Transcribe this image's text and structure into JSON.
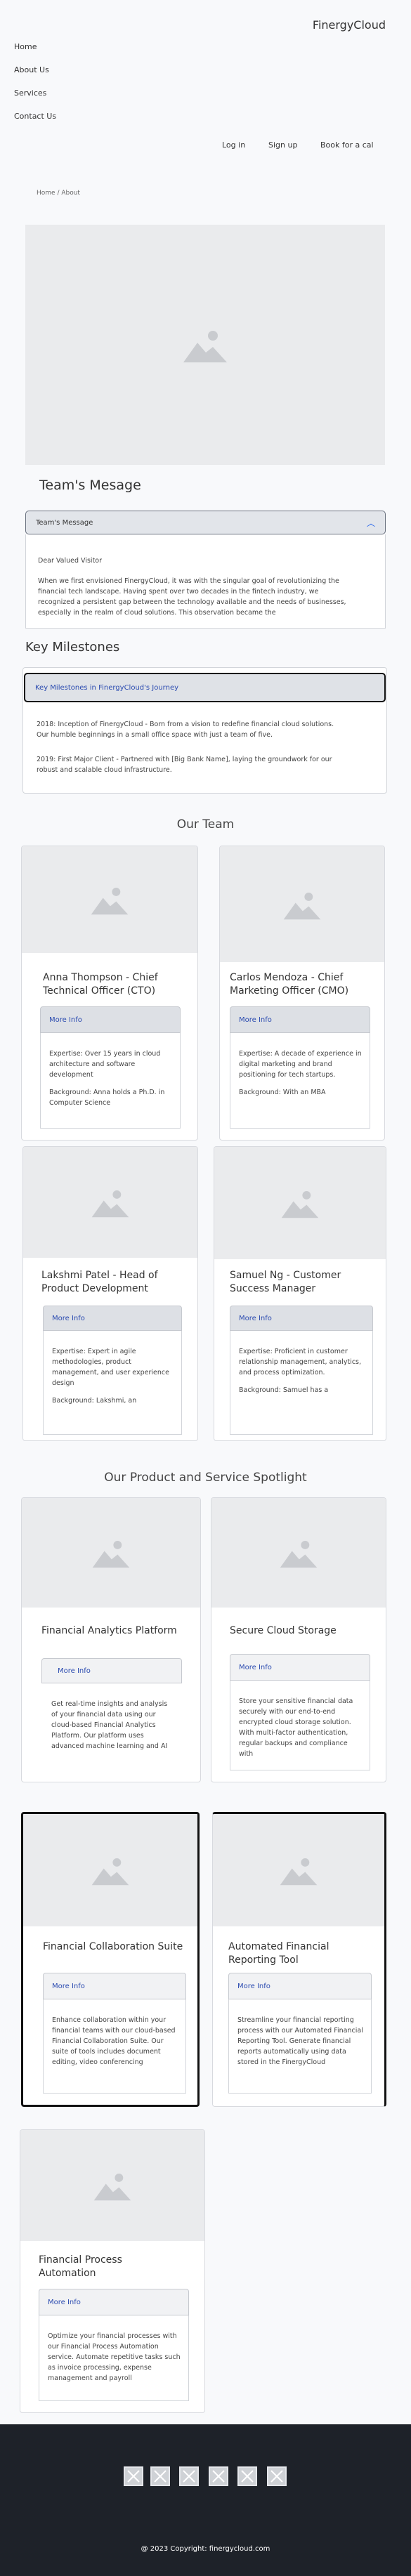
{
  "header": {
    "brand": "FinergyCloud",
    "nav": [
      "Home",
      "About Us",
      "Services",
      "Contact Us"
    ],
    "actions": [
      "Log in",
      "Sign up",
      "Book for a cal"
    ]
  },
  "breadcrumb": "Home / About",
  "team_message": {
    "title": "Team's Mesage",
    "accordion_label": "Team's Message",
    "greeting": "Dear Valued Visitor",
    "body": "When we first envisioned FinergyCloud, it was with the singular goal of revolutionizing the financial tech landscape. Having spent over two decades in the fintech industry, we recognized a persistent gap between the technology available and the needs of businesses, especially in the realm of cloud solutions. This observation became the"
  },
  "milestones": {
    "title": "Key Milestones",
    "accordion_label": "Key Milestones in FinergyCloud's Journey",
    "items": [
      "2018: Inception of FinergyCloud - Born from a vision to redefine financial cloud solutions. Our humble beginnings in a small office space with just a team of five.",
      "2019: First Major Client - Partnered with [Big Bank Name], laying the groundwork for our robust and scalable cloud infrastructure."
    ]
  },
  "team": {
    "title": "Our Team",
    "more_label": "More Info",
    "members": [
      {
        "name": "Anna Thompson - Chief Technical Officer (CTO)",
        "expertise": "Expertise: Over 15 years in cloud architecture and software development",
        "background": "Background: Anna holds a Ph.D. in Computer Science"
      },
      {
        "name": "Carlos Mendoza - Chief Marketing Officer (CMO)",
        "expertise": "Expertise: A decade of experience in digital marketing and brand positioning for tech startups.",
        "background": "Background: With an MBA"
      },
      {
        "name": "Lakshmi Patel - Head of Product Development",
        "expertise": "Expertise: Expert in agile methodologies, product management, and user experience design",
        "background": "Background: Lakshmi, an"
      },
      {
        "name": "Samuel Ng - Customer Success Manager",
        "expertise": "Expertise: Proficient in customer relationship management, analytics, and process optimization.",
        "background": "Background: Samuel has a"
      }
    ]
  },
  "products": {
    "title": "Our Product and Service Spotlight",
    "more_label": "More Info",
    "items": [
      {
        "name": "Financial Analytics Platform",
        "desc": "Get real-time insights and analysis of your financial data using our cloud-based Financial Analytics Platform. Our platform uses advanced machine learning and AI"
      },
      {
        "name": "Secure Cloud Storage",
        "desc": "Store your sensitive financial data securely with our end-to-end encrypted cloud storage solution. With multi-factor authentication, regular backups and compliance with"
      },
      {
        "name": "Financial Collaboration Suite",
        "desc": "Enhance collaboration within your financial teams with our cloud-based Financial Collaboration Suite. Our suite of tools includes document editing, video conferencing"
      },
      {
        "name": "Automated Financial Reporting Tool",
        "desc": "Streamline your financial reporting process with our Automated Financial Reporting Tool. Generate financial reports automatically using data stored in the FinergyCloud"
      },
      {
        "name": "Financial Process Automation",
        "desc": "Optimize your financial processes with our Financial Process Automation service. Automate repetitive tasks such as invoice processing, expense management and payroll"
      }
    ]
  },
  "footer": {
    "social_icons": [
      "image-icon",
      "image-icon",
      "image-icon",
      "image-icon",
      "image-icon",
      "image-icon"
    ],
    "copyright": "@ 2023 Copyright: finergycloud.com"
  },
  "colors": {
    "background": "#f8f9fb",
    "footer": "#1e2229",
    "accent": "#2563eb",
    "placeholder": "#eaebed"
  }
}
